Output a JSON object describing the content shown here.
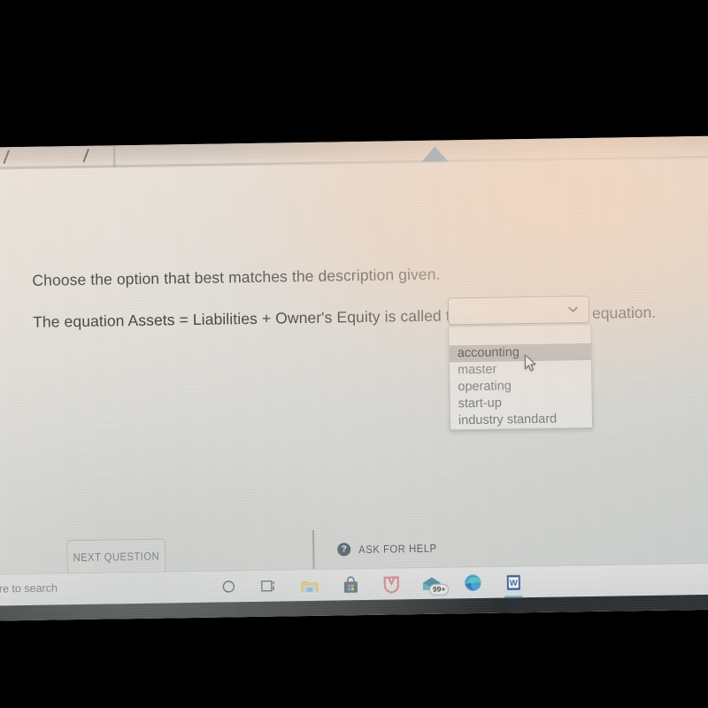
{
  "photo": {
    "description": "Photograph of a laptop screen showing an online accounting quiz question with an open dropdown"
  },
  "browser_chrome": {
    "scroll_arrow_icon": "triangle-up-icon"
  },
  "quiz": {
    "instruction": "Choose the option that best matches the description given.",
    "question_prefix": "The equation Assets = Liabilities + Owner's Equity is called the",
    "question_suffix": "equation.",
    "dropdown": {
      "selected_value": "",
      "chevron_icon": "chevron-down-icon",
      "options": [
        {
          "label": "",
          "selected": false
        },
        {
          "label": "accounting",
          "selected": true
        },
        {
          "label": "master",
          "selected": false
        },
        {
          "label": "operating",
          "selected": false
        },
        {
          "label": "start-up",
          "selected": false
        },
        {
          "label": "industry standard",
          "selected": false
        }
      ]
    },
    "next_question_label": "NEXT QUESTION",
    "ask_for_help_label": "ASK FOR HELP",
    "ask_for_help_icon": "question-mark-circle-icon",
    "cursor_icon": "mouse-pointer-icon"
  },
  "taskbar": {
    "search_text": "ere to search",
    "items": [
      {
        "name": "cortana-icon",
        "label": "Cortana"
      },
      {
        "name": "task-view-icon",
        "label": "Task View"
      },
      {
        "name": "file-explorer-icon",
        "label": "File Explorer"
      },
      {
        "name": "microsoft-store-icon",
        "label": "Microsoft Store"
      },
      {
        "name": "mcafee-icon",
        "label": "McAfee"
      },
      {
        "name": "mail-icon",
        "label": "Mail",
        "badge": "99+"
      },
      {
        "name": "microsoft-edge-icon",
        "label": "Microsoft Edge"
      },
      {
        "name": "microsoft-word-icon",
        "label": "Word"
      }
    ]
  },
  "colors": {
    "accent_blue": "#1f6d97",
    "highlight_row": "#b3b2b1",
    "help_icon": "#2b3a4a",
    "badge_underline": "#5aa5d8"
  }
}
